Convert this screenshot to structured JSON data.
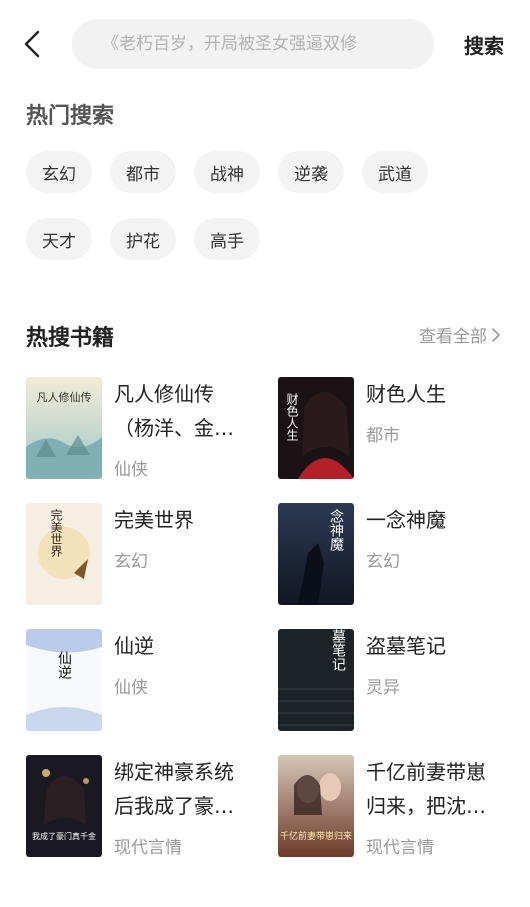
{
  "search": {
    "placeholder": "《老朽百岁，开局被圣女强逼双修",
    "submit_label": "搜索"
  },
  "hot_search": {
    "title": "热门搜索",
    "tags": [
      "玄幻",
      "都市",
      "战神",
      "逆袭",
      "武道",
      "天才",
      "护花",
      "高手"
    ]
  },
  "hot_books": {
    "title": "热搜书籍",
    "view_all_label": "查看全部",
    "books": [
      {
        "title": "凡人修仙传（杨洋、金…",
        "genre": "仙侠",
        "cover_text": "凡人修仙传"
      },
      {
        "title": "财色人生",
        "genre": "都市",
        "cover_text": "财色人生"
      },
      {
        "title": "完美世界",
        "genre": "玄幻",
        "cover_text": "完美世界"
      },
      {
        "title": "一念神魔",
        "genre": "玄幻",
        "cover_text": "一念神魔"
      },
      {
        "title": "仙逆",
        "genre": "仙侠",
        "cover_text": "仙逆"
      },
      {
        "title": "盗墓笔记",
        "genre": "灵异",
        "cover_text": "盗墓笔记"
      },
      {
        "title": "绑定神豪系统后我成了豪…",
        "genre": "现代言情",
        "cover_text": "我成了豪门真千金"
      },
      {
        "title": "千亿前妻带崽归来，把沈…",
        "genre": "现代言情",
        "cover_text": "千亿前妻带崽归来"
      }
    ]
  }
}
